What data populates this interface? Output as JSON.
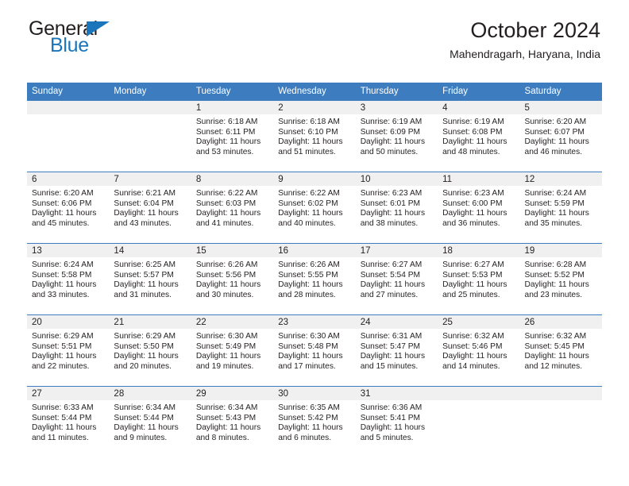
{
  "brand": {
    "name_top": "General",
    "name_bottom": "Blue",
    "accent_color": "#1b75bb",
    "triangle_icon": "triangle-icon"
  },
  "header": {
    "title": "October 2024",
    "subtitle": "Mahendragarh, Haryana, India"
  },
  "theme": {
    "header_bg": "#3d7dbf",
    "header_text": "#ffffff",
    "daynum_bg": "#f0f0f0",
    "text": "#231f20"
  },
  "weekday_headers": [
    "Sunday",
    "Monday",
    "Tuesday",
    "Wednesday",
    "Thursday",
    "Friday",
    "Saturday"
  ],
  "weeks": [
    [
      {
        "day": "",
        "lines": []
      },
      {
        "day": "",
        "lines": []
      },
      {
        "day": "1",
        "lines": [
          "Sunrise: 6:18 AM",
          "Sunset: 6:11 PM",
          "Daylight: 11 hours",
          "and 53 minutes."
        ]
      },
      {
        "day": "2",
        "lines": [
          "Sunrise: 6:18 AM",
          "Sunset: 6:10 PM",
          "Daylight: 11 hours",
          "and 51 minutes."
        ]
      },
      {
        "day": "3",
        "lines": [
          "Sunrise: 6:19 AM",
          "Sunset: 6:09 PM",
          "Daylight: 11 hours",
          "and 50 minutes."
        ]
      },
      {
        "day": "4",
        "lines": [
          "Sunrise: 6:19 AM",
          "Sunset: 6:08 PM",
          "Daylight: 11 hours",
          "and 48 minutes."
        ]
      },
      {
        "day": "5",
        "lines": [
          "Sunrise: 6:20 AM",
          "Sunset: 6:07 PM",
          "Daylight: 11 hours",
          "and 46 minutes."
        ]
      }
    ],
    [
      {
        "day": "6",
        "lines": [
          "Sunrise: 6:20 AM",
          "Sunset: 6:06 PM",
          "Daylight: 11 hours",
          "and 45 minutes."
        ]
      },
      {
        "day": "7",
        "lines": [
          "Sunrise: 6:21 AM",
          "Sunset: 6:04 PM",
          "Daylight: 11 hours",
          "and 43 minutes."
        ]
      },
      {
        "day": "8",
        "lines": [
          "Sunrise: 6:22 AM",
          "Sunset: 6:03 PM",
          "Daylight: 11 hours",
          "and 41 minutes."
        ]
      },
      {
        "day": "9",
        "lines": [
          "Sunrise: 6:22 AM",
          "Sunset: 6:02 PM",
          "Daylight: 11 hours",
          "and 40 minutes."
        ]
      },
      {
        "day": "10",
        "lines": [
          "Sunrise: 6:23 AM",
          "Sunset: 6:01 PM",
          "Daylight: 11 hours",
          "and 38 minutes."
        ]
      },
      {
        "day": "11",
        "lines": [
          "Sunrise: 6:23 AM",
          "Sunset: 6:00 PM",
          "Daylight: 11 hours",
          "and 36 minutes."
        ]
      },
      {
        "day": "12",
        "lines": [
          "Sunrise: 6:24 AM",
          "Sunset: 5:59 PM",
          "Daylight: 11 hours",
          "and 35 minutes."
        ]
      }
    ],
    [
      {
        "day": "13",
        "lines": [
          "Sunrise: 6:24 AM",
          "Sunset: 5:58 PM",
          "Daylight: 11 hours",
          "and 33 minutes."
        ]
      },
      {
        "day": "14",
        "lines": [
          "Sunrise: 6:25 AM",
          "Sunset: 5:57 PM",
          "Daylight: 11 hours",
          "and 31 minutes."
        ]
      },
      {
        "day": "15",
        "lines": [
          "Sunrise: 6:26 AM",
          "Sunset: 5:56 PM",
          "Daylight: 11 hours",
          "and 30 minutes."
        ]
      },
      {
        "day": "16",
        "lines": [
          "Sunrise: 6:26 AM",
          "Sunset: 5:55 PM",
          "Daylight: 11 hours",
          "and 28 minutes."
        ]
      },
      {
        "day": "17",
        "lines": [
          "Sunrise: 6:27 AM",
          "Sunset: 5:54 PM",
          "Daylight: 11 hours",
          "and 27 minutes."
        ]
      },
      {
        "day": "18",
        "lines": [
          "Sunrise: 6:27 AM",
          "Sunset: 5:53 PM",
          "Daylight: 11 hours",
          "and 25 minutes."
        ]
      },
      {
        "day": "19",
        "lines": [
          "Sunrise: 6:28 AM",
          "Sunset: 5:52 PM",
          "Daylight: 11 hours",
          "and 23 minutes."
        ]
      }
    ],
    [
      {
        "day": "20",
        "lines": [
          "Sunrise: 6:29 AM",
          "Sunset: 5:51 PM",
          "Daylight: 11 hours",
          "and 22 minutes."
        ]
      },
      {
        "day": "21",
        "lines": [
          "Sunrise: 6:29 AM",
          "Sunset: 5:50 PM",
          "Daylight: 11 hours",
          "and 20 minutes."
        ]
      },
      {
        "day": "22",
        "lines": [
          "Sunrise: 6:30 AM",
          "Sunset: 5:49 PM",
          "Daylight: 11 hours",
          "and 19 minutes."
        ]
      },
      {
        "day": "23",
        "lines": [
          "Sunrise: 6:30 AM",
          "Sunset: 5:48 PM",
          "Daylight: 11 hours",
          "and 17 minutes."
        ]
      },
      {
        "day": "24",
        "lines": [
          "Sunrise: 6:31 AM",
          "Sunset: 5:47 PM",
          "Daylight: 11 hours",
          "and 15 minutes."
        ]
      },
      {
        "day": "25",
        "lines": [
          "Sunrise: 6:32 AM",
          "Sunset: 5:46 PM",
          "Daylight: 11 hours",
          "and 14 minutes."
        ]
      },
      {
        "day": "26",
        "lines": [
          "Sunrise: 6:32 AM",
          "Sunset: 5:45 PM",
          "Daylight: 11 hours",
          "and 12 minutes."
        ]
      }
    ],
    [
      {
        "day": "27",
        "lines": [
          "Sunrise: 6:33 AM",
          "Sunset: 5:44 PM",
          "Daylight: 11 hours",
          "and 11 minutes."
        ]
      },
      {
        "day": "28",
        "lines": [
          "Sunrise: 6:34 AM",
          "Sunset: 5:44 PM",
          "Daylight: 11 hours",
          "and 9 minutes."
        ]
      },
      {
        "day": "29",
        "lines": [
          "Sunrise: 6:34 AM",
          "Sunset: 5:43 PM",
          "Daylight: 11 hours",
          "and 8 minutes."
        ]
      },
      {
        "day": "30",
        "lines": [
          "Sunrise: 6:35 AM",
          "Sunset: 5:42 PM",
          "Daylight: 11 hours",
          "and 6 minutes."
        ]
      },
      {
        "day": "31",
        "lines": [
          "Sunrise: 6:36 AM",
          "Sunset: 5:41 PM",
          "Daylight: 11 hours",
          "and 5 minutes."
        ]
      },
      {
        "day": "",
        "lines": []
      },
      {
        "day": "",
        "lines": []
      }
    ]
  ]
}
